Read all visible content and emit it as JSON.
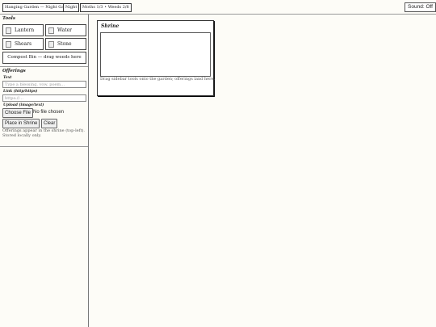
{
  "topbar": {
    "title": "Hanging Garden — Night Garden",
    "mode": "Night",
    "counts": "Moths 1/3 • Weeds 2/8",
    "sound_label": "Sound: Off"
  },
  "tools": {
    "title": "Tools",
    "items": [
      {
        "label": "Lantern",
        "icon": "lantern-icon"
      },
      {
        "label": "Water",
        "icon": "water-icon"
      },
      {
        "label": "Shears",
        "icon": "shears-icon"
      },
      {
        "label": "Stone",
        "icon": "stone-icon"
      }
    ],
    "compost_label": "Compost Bin — drag weeds here"
  },
  "offerings": {
    "title": "Offerings",
    "text_label": "Text",
    "text_placeholder": "Type a blessing, vow, poem…",
    "link_label": "Link (http/https)",
    "link_placeholder": "https://…",
    "upload_label": "Upload (image/text)",
    "choose_file": "Choose File",
    "no_file": "No file chosen",
    "place_button": "Place in Shrine",
    "clear_button": "Clear",
    "note": "Offerings appear in the shrine (top-left). Stored locally only."
  },
  "shrine": {
    "title": "Shrine",
    "hint": "Drag sidebar tools onto the garden; offerings land here."
  }
}
